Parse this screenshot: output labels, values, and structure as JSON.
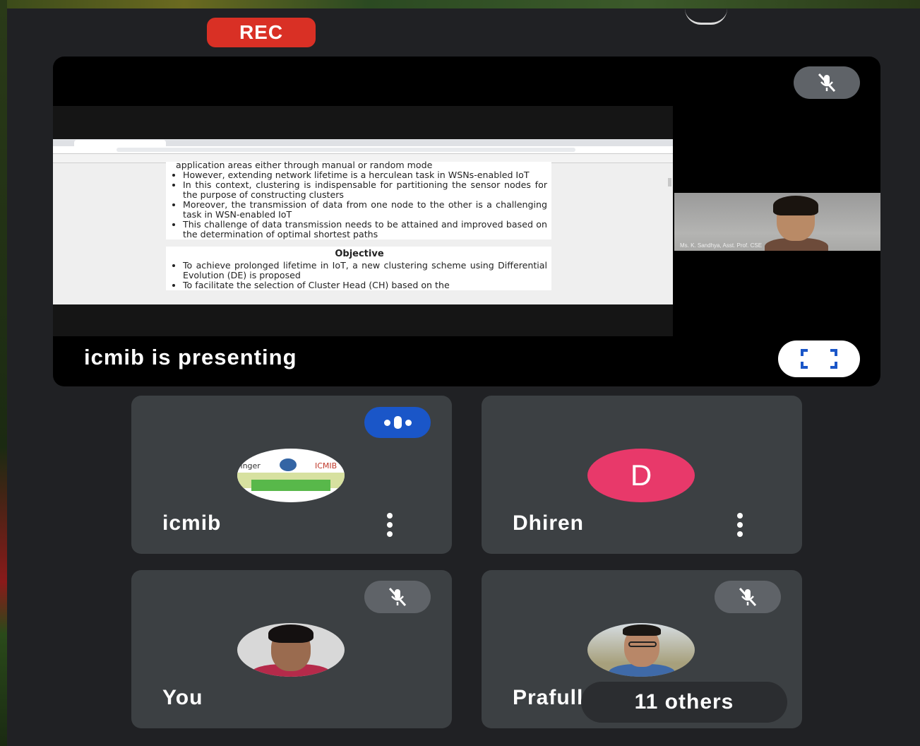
{
  "recording": {
    "label": "REC"
  },
  "presentation": {
    "presenting_text": "icmib is presenting",
    "slide": {
      "bullets_top": [
        "application areas either through manual or random mode",
        "However, extending network lifetime is a herculean task in WSNs-enabled IoT",
        "In this context, clustering is indispensable for partitioning the sensor nodes for the purpose of constructing clusters",
        "Moreover, the transmission of data from one node to the other is a challenging task in WSN-enabled IoT",
        "This challenge of data transmission needs to be attained and improved based on the determination of optimal shortest paths"
      ],
      "objective_title": "Objective",
      "objective_bullets": [
        "To achieve prolonged lifetime in IoT, a new clustering scheme using Differential Evolution (DE) is proposed",
        "To facilitate the selection of Cluster Head (CH) based on the"
      ]
    },
    "thumbnail_name": "Ms. K. Sandhya, Asst. Prof. CSE"
  },
  "participants": [
    {
      "name": "icmib",
      "avatar": {
        "type": "logo",
        "line1": "ringer",
        "line1b": "ICMIB"
      },
      "status": "speaking",
      "more_icon": "more-vert-icon"
    },
    {
      "name": "Dhiren",
      "avatar": {
        "type": "letter",
        "letter": "D",
        "color": "#e8396a"
      },
      "status": "none",
      "more_icon": "more-vert-icon"
    },
    {
      "name": "You",
      "avatar": {
        "type": "photo"
      },
      "status": "muted"
    },
    {
      "name": "Prafulla Kumar",
      "avatar": {
        "type": "photo"
      },
      "status": "muted"
    }
  ],
  "others_label": "11 others",
  "colors": {
    "rec": "#d93025",
    "speaking": "#1a56c8",
    "tile_bg": "#3c4043",
    "mic_off_bg": "#5f6368"
  }
}
